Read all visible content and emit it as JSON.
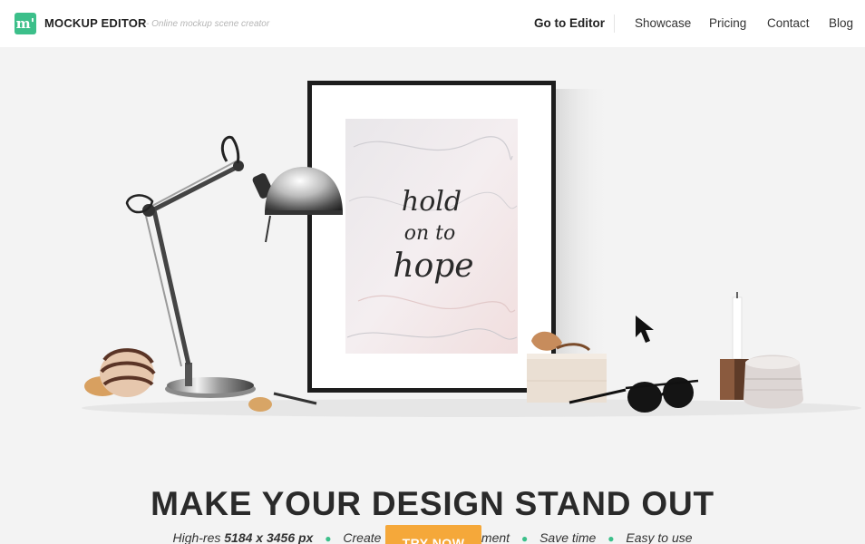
{
  "header": {
    "logo_glyph": "m'",
    "brand": "MOCKUP EDITOR",
    "tagline": "- Online mockup scene creator",
    "nav": {
      "go_to_editor": "Go to Editor",
      "showcase": "Showcase",
      "pricing": "Pricing",
      "contact": "Contact",
      "blog": "Blog"
    }
  },
  "hero": {
    "poster_text": [
      "hold",
      "on to",
      "hope"
    ],
    "headline": "MAKE YOUR DESIGN STAND OUT",
    "features": {
      "f1_prefix": "High-res ",
      "f1_bold": "5184 x 3456 px",
      "f2": "Create your own environment",
      "f3": "Save time",
      "f4": "Easy to use",
      "separator": "●"
    },
    "cta_label": "TRY NOW"
  },
  "colors": {
    "brand_green": "#3cbf8a",
    "cta_orange": "#f5a83a",
    "background": "#f3f3f3"
  },
  "icons": {
    "cursor": "mouse-pointer-icon"
  }
}
